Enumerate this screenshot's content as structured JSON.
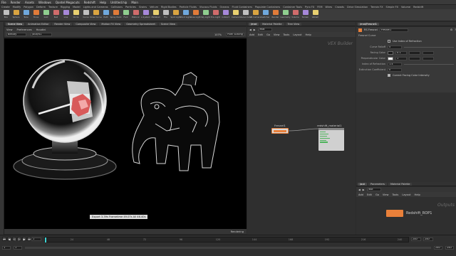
{
  "menubar": [
    "File",
    "Render",
    "Assets",
    "Windows",
    "Qontel Megacuts",
    "Redshift",
    "Help",
    "Untitled.hip",
    "Main"
  ],
  "shelf_tabs": [
    "Create",
    "Modify",
    "Polygon",
    "Deform",
    "Texture",
    "Rigging",
    "Model",
    "Lights and Cameras",
    "Collisions",
    "Particles",
    "Grains",
    "Vellum",
    "Rigid Bodies",
    "Particle Fluids",
    "Viscous Fluids",
    "Oceans",
    "Fluid Containers",
    "Populate Containers",
    "Container Tools",
    "Pyro FX",
    "FEM",
    "Wires",
    "Crowds",
    "Drive Simulation",
    "Terrain FX",
    "Simple FX",
    "Volume",
    "Redshift"
  ],
  "shelf_tools": [
    "Box",
    "Sphere",
    "Tube",
    "Torus",
    "Grid",
    "Null",
    "Line",
    "Circle",
    "Curve",
    "Draw Curve",
    "Path",
    "Spray Paint",
    "Font",
    "Platonic",
    "L-System",
    "Metaball",
    "File",
    "Spot Light",
    "Point Light",
    "Area Light",
    "Sky Light",
    "Env Light",
    "Indirect",
    "Camera",
    "Stereo Cam",
    "VR Camera",
    "Switcher",
    "Render",
    "Geometry",
    "Volume",
    "Terrain",
    "Vellum"
  ],
  "left_tabs": [
    "Scene View",
    "Animation Editor",
    "Render View",
    "Composite View",
    "Motion FX View",
    "Geometry Spreadsheet",
    "Scene View"
  ],
  "viewport": {
    "menu": [
      "View",
      "Preferences",
      "Houdini"
    ],
    "object_label": "Beauty",
    "camera_label": "/out/rs1",
    "zoom": "107%",
    "scale_label": "Pixel Scaling",
    "status": "Export 3.39s  Frametime 49.07s  All 46.40s",
    "rendering": "Rendering"
  },
  "network": {
    "path_tabs": [
      "/mat",
      "Material Palette",
      "Tree View"
    ],
    "path": "/mat",
    "menu": [
      "Add",
      "Edit",
      "Go",
      "View",
      "Tools",
      "Layout",
      "Help"
    ],
    "title": "VEX Builder",
    "node_fresnel": "Fresnel1",
    "node_material": "redshift_material1"
  },
  "params": {
    "tab": "/mat/Fresnel1",
    "node_type": "RS Fresnel",
    "node_name": "Fresnel1",
    "section": "Fresnel Curve",
    "rows": [
      {
        "label": "",
        "value": "Use Index of Refraction"
      },
      {
        "label": "Curve Falloff",
        "value": "5"
      },
      {
        "label": "Facing Color",
        "value": "0.1"
      },
      {
        "label": "Perpendicular Color",
        "value": "1"
      },
      {
        "label": "Index of Refraction",
        "value": "1.4"
      },
      {
        "label": "Extinction Coefficient",
        "value": "0"
      },
      {
        "label": "",
        "value": "Correct Facing Color Intensity"
      }
    ]
  },
  "output": {
    "tabs": [
      "/out",
      "Parameters",
      "Material Palette"
    ],
    "menu": [
      "Add",
      "Edit",
      "Go",
      "View",
      "Tools",
      "Layout",
      "Help"
    ],
    "path": "/out",
    "title": "Outputs",
    "node": "Redshift_ROP1"
  },
  "timeline": {
    "frame": "1",
    "start": "1",
    "end": "240",
    "end2": "240",
    "tick_labels": [
      "24",
      "48",
      "72",
      "96",
      "120",
      "144",
      "168",
      "192",
      "216",
      "240"
    ]
  },
  "colors": {
    "accent_orange": "#e9803a",
    "node_green": "#4db35b",
    "viewport_bg": "#000000"
  }
}
